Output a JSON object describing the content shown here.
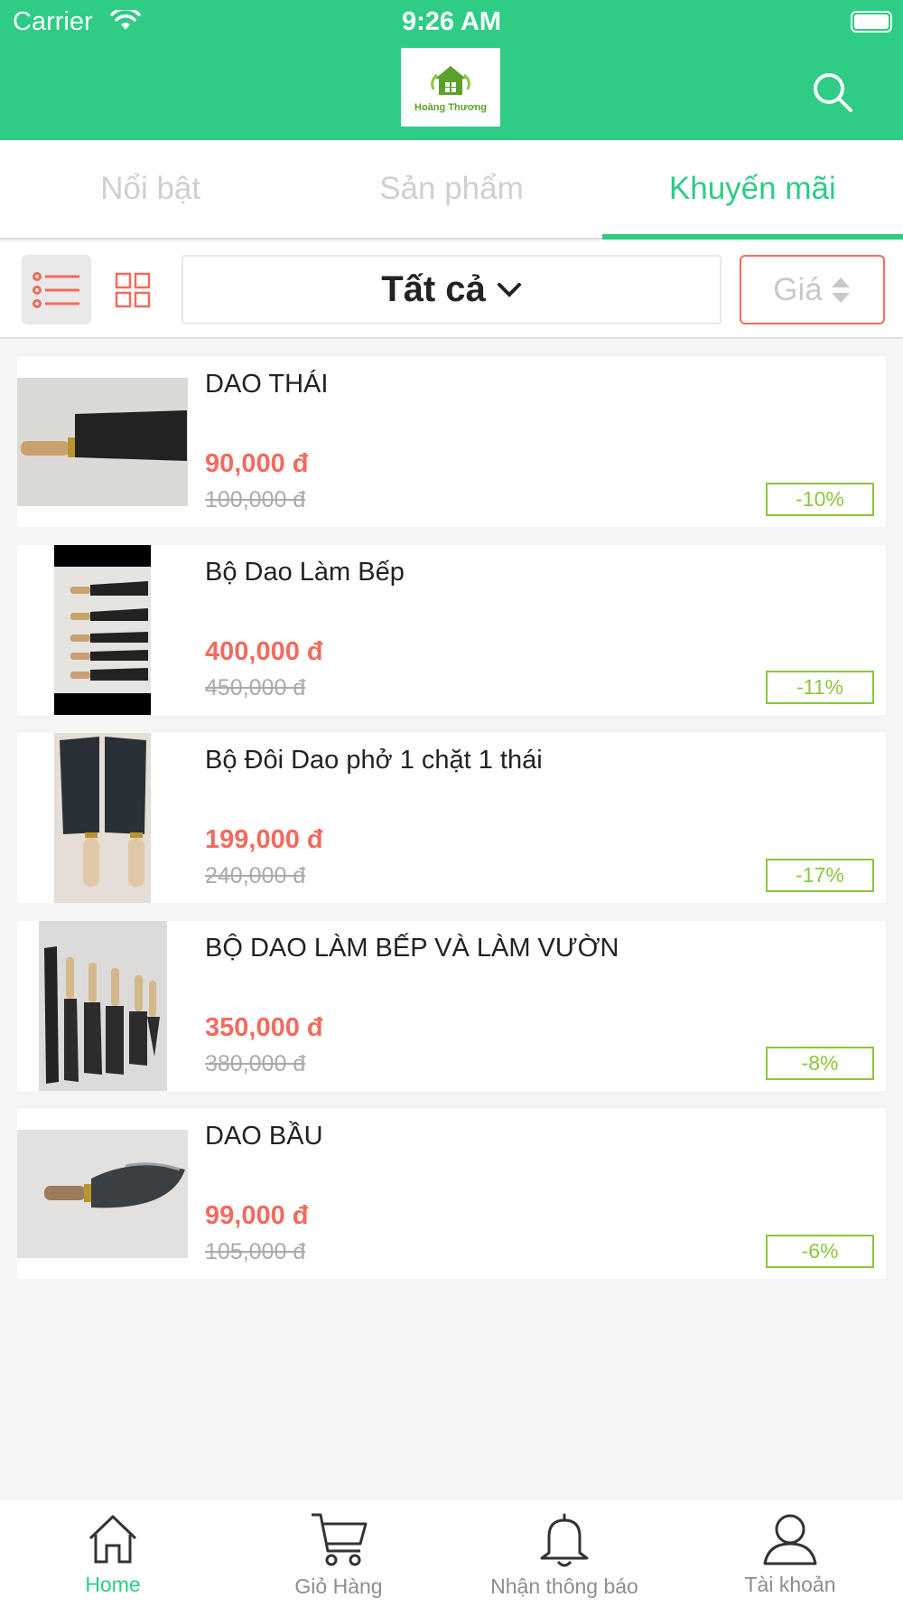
{
  "status_bar": {
    "carrier": "Carrier",
    "time": "9:26 AM"
  },
  "header": {
    "logo_text": "Hoàng Thương"
  },
  "tabs": [
    {
      "label": "Nổi bật",
      "active": false
    },
    {
      "label": "Sản phẩm",
      "active": false
    },
    {
      "label": "Khuyến mãi",
      "active": true
    }
  ],
  "toolbar": {
    "filter_label": "Tất cả",
    "sort_label": "Giá"
  },
  "products": [
    {
      "name": "DAO THÁI",
      "price": "90,000 đ",
      "old_price": "100,000 đ",
      "discount": "-10%"
    },
    {
      "name": "Bộ Dao Làm Bếp",
      "price": "400,000 đ",
      "old_price": "450,000 đ",
      "discount": "-11%"
    },
    {
      "name": "Bộ Đôi Dao phở 1 chặt 1 thái",
      "price": "199,000 đ",
      "old_price": "240,000 đ",
      "discount": "-17%"
    },
    {
      "name": "BỘ DAO LÀM BẾP VÀ LÀM VƯỜN",
      "price": "350,000 đ",
      "old_price": "380,000 đ",
      "discount": "-8%"
    },
    {
      "name": "DAO BẦU",
      "price": "99,000 đ",
      "old_price": "105,000 đ",
      "discount": "-6%"
    }
  ],
  "bottom_nav": [
    {
      "label": "Home",
      "icon": "home-icon",
      "active": true
    },
    {
      "label": "Giỏ Hàng",
      "icon": "cart-icon",
      "active": false
    },
    {
      "label": "Nhận thông báo",
      "icon": "bell-icon",
      "active": false
    },
    {
      "label": "Tài khoản",
      "icon": "user-icon",
      "active": false
    }
  ],
  "colors": {
    "brand": "#2ecc85",
    "price": "#f26b5e",
    "discount": "#8dc63f"
  }
}
